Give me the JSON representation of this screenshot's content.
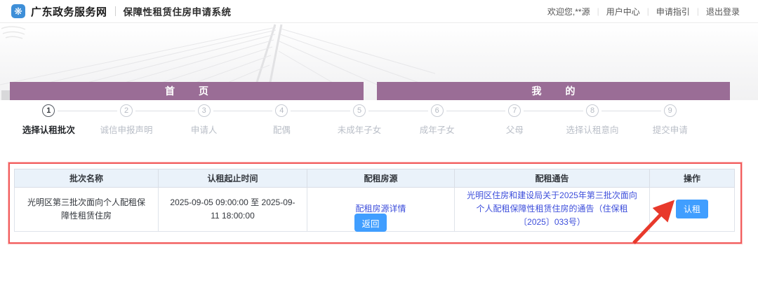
{
  "header": {
    "logo_icon": "flower-icon",
    "logo_glyph": "❋",
    "brand": "广东政务服务网",
    "system_title": "保障性租赁住房申请系统",
    "user_links": {
      "welcome": "欢迎您,**源",
      "user_center": "用户中心",
      "guide": "申请指引",
      "logout": "退出登录"
    }
  },
  "tabs": [
    {
      "label": "首　页",
      "active": true
    },
    {
      "label": "我　的",
      "active": false
    }
  ],
  "steps": [
    {
      "num": "1",
      "label": "选择认租批次",
      "active": true
    },
    {
      "num": "2",
      "label": "诚信申报声明",
      "active": false
    },
    {
      "num": "3",
      "label": "申请人",
      "active": false
    },
    {
      "num": "4",
      "label": "配偶",
      "active": false
    },
    {
      "num": "5",
      "label": "未成年子女",
      "active": false
    },
    {
      "num": "6",
      "label": "成年子女",
      "active": false
    },
    {
      "num": "7",
      "label": "父母",
      "active": false
    },
    {
      "num": "8",
      "label": "选择认租意向",
      "active": false
    },
    {
      "num": "9",
      "label": "提交申请",
      "active": false
    }
  ],
  "table": {
    "headers": [
      "批次名称",
      "认租起止时间",
      "配租房源",
      "配租通告",
      "操作"
    ],
    "rows": [
      {
        "batch_name": "光明区第三批次面向个人配租保障性租赁住房",
        "time_range": "2025-09-05 09:00:00 至 2025-09-11 18:00:00",
        "house_link": "配租房源详情",
        "notice_link": "光明区住房和建设局关于2025年第三批次面向个人配租保障性租赁住房的通告（住保租〔2025〕033号）",
        "action_label": "认租"
      }
    ]
  },
  "buttons": {
    "back": "返回"
  },
  "colors": {
    "tab_purple": "#9A6D96",
    "primary_blue": "#409EFF",
    "link_blue": "#3D4EDB",
    "logo_blue": "#3E8FD8",
    "highlight_red": "#F25C5C",
    "table_header_bg": "#EAF2FA"
  }
}
